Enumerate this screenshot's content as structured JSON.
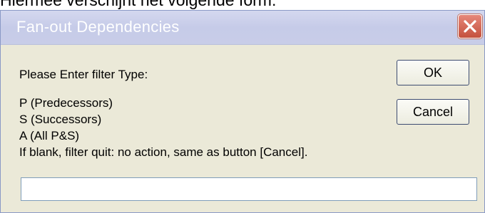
{
  "caption": "Hiermee verschijnt het volgende form:",
  "window": {
    "title": "Fan-out Dependencies",
    "close_glyph": "✕"
  },
  "prompt": "Please Enter filter Type:",
  "options": [
    "P (Predecessors)",
    "S (Successors)",
    "A (All P&S)",
    "If blank, filter quit: no action, same as button [Cancel]."
  ],
  "buttons": {
    "ok": "OK",
    "cancel": "Cancel"
  },
  "input": {
    "value": ""
  },
  "colors": {
    "title_bar": "#c6cbe8",
    "title_text": "#ffffff",
    "close_button": "#c4513e",
    "dialog_bg": "#ebe9d8"
  }
}
